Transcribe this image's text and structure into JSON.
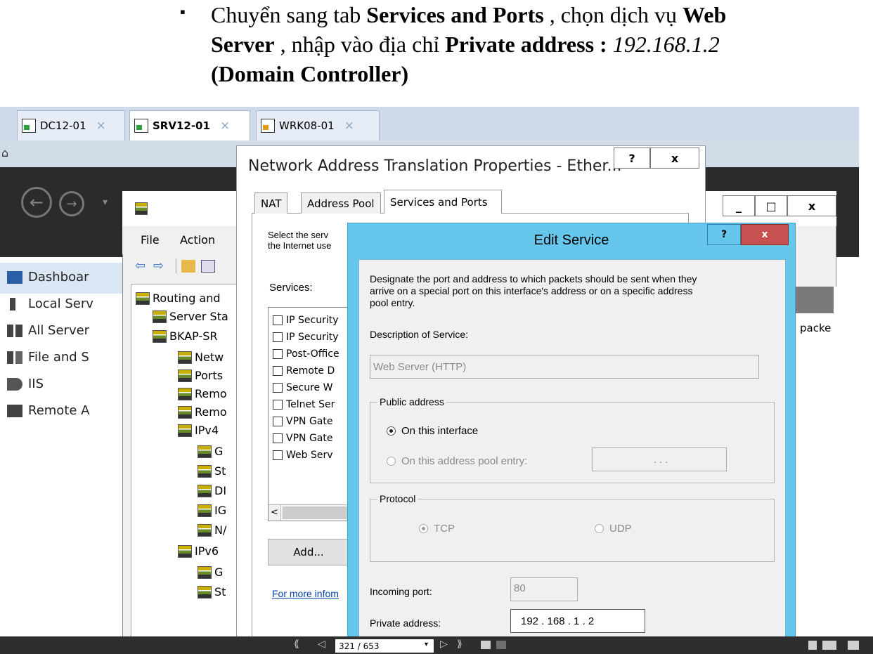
{
  "document": {
    "bullet": "▪",
    "line1_pre": "Chuyển sang tab ",
    "line1_bold": "Services and Ports",
    "line1_mid": " , chọn dịch vụ ",
    "line1_bold2": "Web",
    "line2_bold": "Server",
    "line2_mid": " , nhập vào địa chỉ ",
    "line2_bold2": "Private address : ",
    "line2_italic": "192.168.1.2",
    "line3_bold": "(Domain Controller)"
  },
  "host_tabs": [
    {
      "label": "DC12-01",
      "close": "×"
    },
    {
      "label": "SRV12-01",
      "close": "×"
    },
    {
      "label": "WRK08-01",
      "close": "×"
    }
  ],
  "server_manager": {
    "sidebar": [
      {
        "label": "Dashboar",
        "icon": "dashboard-icon"
      },
      {
        "label": "Local Serv",
        "icon": "server-icon"
      },
      {
        "label": "All Server",
        "icon": "servers-icon"
      },
      {
        "label": "File and S",
        "icon": "file-storage-icon"
      },
      {
        "label": "IIS",
        "icon": "iis-icon"
      },
      {
        "label": "Remote A",
        "icon": "remote-access-icon"
      }
    ]
  },
  "rras": {
    "menu": [
      "File",
      "Action"
    ],
    "tree": [
      {
        "label": "Routing and",
        "indent": 0
      },
      {
        "label": "Server Sta",
        "indent": 1
      },
      {
        "label": "BKAP-SR",
        "indent": 1
      },
      {
        "label": "Netw",
        "indent": 2
      },
      {
        "label": "Ports",
        "indent": 2
      },
      {
        "label": "Remo",
        "indent": 2
      },
      {
        "label": "Remo",
        "indent": 2
      },
      {
        "label": "IPv4",
        "indent": 2
      },
      {
        "label": "G",
        "indent": 3
      },
      {
        "label": "St",
        "indent": 3
      },
      {
        "label": "DI",
        "indent": 3
      },
      {
        "label": "IG",
        "indent": 3
      },
      {
        "label": "N/",
        "indent": 3
      },
      {
        "label": "IPv6",
        "indent": 2
      },
      {
        "label": "G",
        "indent": 3
      },
      {
        "label": "St",
        "indent": 3
      }
    ],
    "right_pane_text": "packe",
    "caption_buttons": [
      "_",
      "□",
      "x"
    ]
  },
  "nat_dialog": {
    "title": "Network Address Translation Properties - Ether...",
    "help": "?",
    "close": "x",
    "tabs": [
      "NAT",
      "Address Pool",
      "Services and Ports"
    ],
    "intro_line1": "Select the serv",
    "intro_line2": "the Internet use",
    "services_label": "Services:",
    "services": [
      "IP Security",
      "IP Security",
      "Post-Office",
      "Remote D",
      "Secure W",
      "Telnet Ser",
      "VPN Gate",
      "VPN Gate",
      "Web Serv"
    ],
    "scroll_left": "<",
    "add_button": "Add...",
    "more_info_link": "For more infom"
  },
  "edit_service": {
    "title": "Edit Service",
    "help": "?",
    "close": "x",
    "description_text1": "Designate the port and address to which packets should be sent when they",
    "description_text2": "arrive on a special port on this interface's address or on a specific address",
    "description_text3": "pool entry.",
    "desc_label": "Description of Service:",
    "desc_value": "Web Server (HTTP)",
    "public_address_group": "Public address",
    "on_interface": "On this interface",
    "on_pool_entry": "On this address pool entry:",
    "pool_ip": ".        .        .",
    "protocol_group": "Protocol",
    "tcp": "TCP",
    "udp": "UDP",
    "incoming_port_label": "Incoming port:",
    "incoming_port_value": "80",
    "private_address_label": "Private address:",
    "private_address_value": "192 . 168 .  1  .  2"
  },
  "viewer": {
    "page": "321 / 653"
  }
}
